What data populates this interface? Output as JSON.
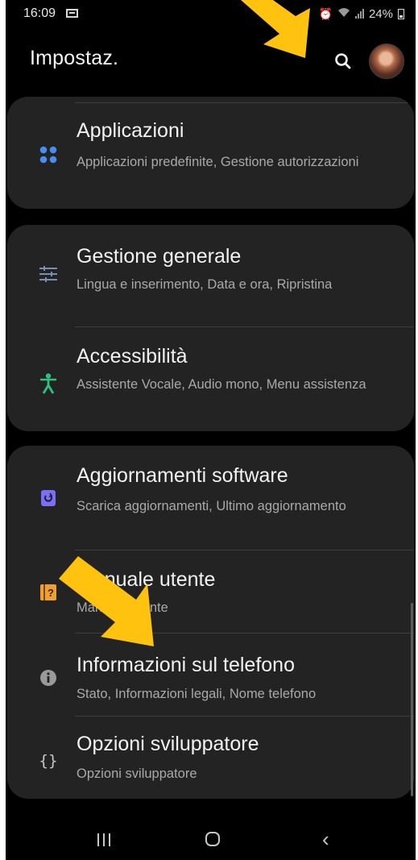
{
  "status_bar": {
    "time": "16:09",
    "battery": "24%"
  },
  "header": {
    "title": "Impostaz."
  },
  "colors": {
    "background": "#000000",
    "card": "#232323",
    "accent_green": "#2ec27e",
    "arrow": "#ffc20e"
  },
  "items": [
    {
      "icon": "apps-icon",
      "title": "Applicazioni",
      "subtitle": "Applicazioni predefinite, Gestione autorizzazioni"
    },
    {
      "icon": "sliders-icon",
      "title": "Gestione generale",
      "subtitle": "Lingua e inserimento, Data e ora, Ripristina"
    },
    {
      "icon": "accessibility-icon",
      "title": "Accessibilità",
      "subtitle": "Assistente Vocale, Audio mono, Menu assistenza"
    },
    {
      "icon": "software-update-icon",
      "title": "Aggiornamenti software",
      "subtitle": "Scarica aggiornamenti, Ultimo aggiornamento"
    },
    {
      "icon": "user-manual-icon",
      "title": "Manuale utente",
      "subtitle": "Manuale utente"
    },
    {
      "icon": "info-icon",
      "title": "Informazioni sul telefono",
      "subtitle": "Stato, Informazioni legali, Nome telefono"
    },
    {
      "icon": "developer-options-icon",
      "title": "Opzioni sviluppatore",
      "subtitle": "Opzioni sviluppatore"
    }
  ]
}
